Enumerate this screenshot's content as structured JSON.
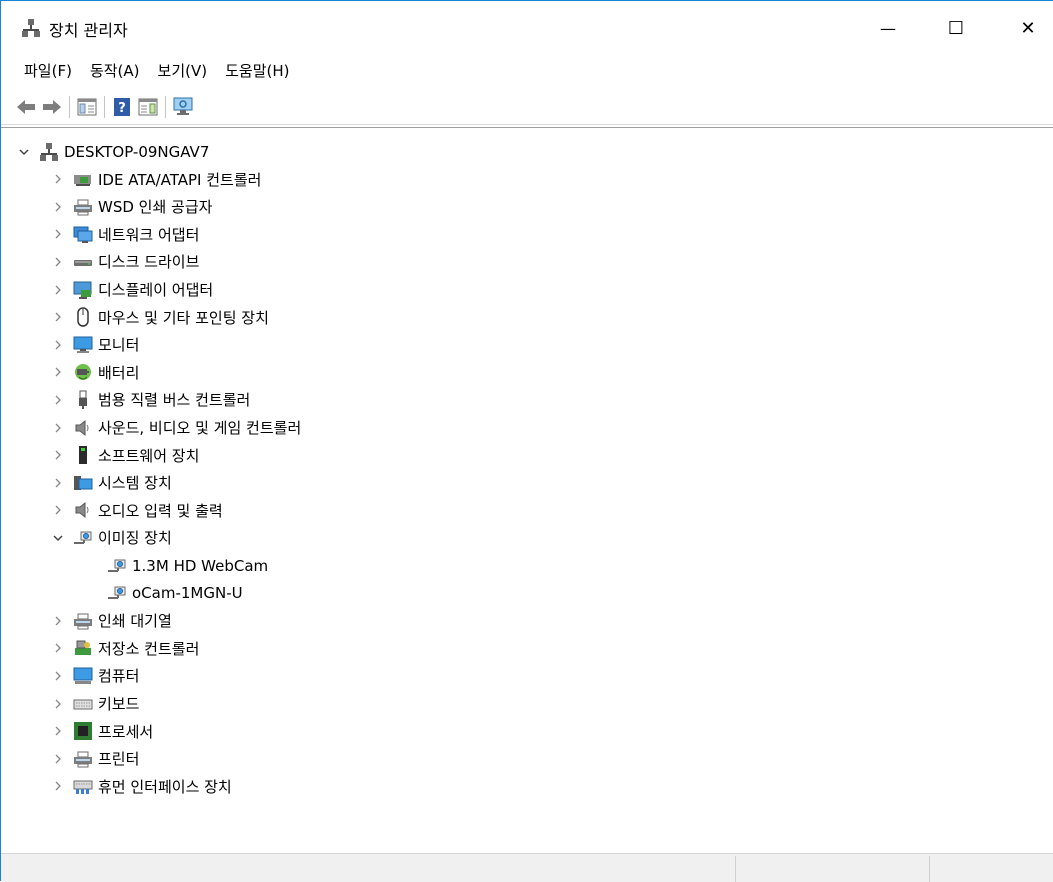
{
  "window": {
    "title": "장치 관리자",
    "minimize_glyph": "—",
    "maximize_glyph": "☐",
    "close_glyph": "✕"
  },
  "menu": [
    "파일(F)",
    "동작(A)",
    "보기(V)",
    "도움말(H)"
  ],
  "tree": {
    "root": {
      "label": "DESKTOP-09NGAV7",
      "icon": "computer-network-icon",
      "expanded": true
    },
    "categories": [
      {
        "label": "IDE ATA/ATAPI 컨트롤러",
        "icon": "ide-controller-icon",
        "expanded": false
      },
      {
        "label": "WSD 인쇄 공급자",
        "icon": "printer-icon",
        "expanded": false
      },
      {
        "label": "네트워크 어댑터",
        "icon": "network-adapter-icon",
        "expanded": false
      },
      {
        "label": "디스크 드라이브",
        "icon": "disk-drive-icon",
        "expanded": false
      },
      {
        "label": "디스플레이 어댑터",
        "icon": "display-adapter-icon",
        "expanded": false
      },
      {
        "label": "마우스 및 기타 포인팅 장치",
        "icon": "mouse-icon",
        "expanded": false
      },
      {
        "label": "모니터",
        "icon": "monitor-icon",
        "expanded": false
      },
      {
        "label": "배터리",
        "icon": "battery-icon",
        "expanded": false
      },
      {
        "label": "범용 직렬 버스 컨트롤러",
        "icon": "usb-icon",
        "expanded": false
      },
      {
        "label": "사운드, 비디오 및 게임 컨트롤러",
        "icon": "speaker-icon",
        "expanded": false
      },
      {
        "label": "소프트웨어 장치",
        "icon": "software-device-icon",
        "expanded": false
      },
      {
        "label": "시스템 장치",
        "icon": "system-device-icon",
        "expanded": false
      },
      {
        "label": "오디오 입력 및 출력",
        "icon": "speaker-icon",
        "expanded": false
      },
      {
        "label": "이미징 장치",
        "icon": "camera-icon",
        "expanded": true,
        "children": [
          {
            "label": "1.3M HD WebCam",
            "icon": "camera-icon"
          },
          {
            "label": "oCam-1MGN-U",
            "icon": "camera-icon"
          }
        ]
      },
      {
        "label": "인쇄 대기열",
        "icon": "printer-icon",
        "expanded": false
      },
      {
        "label": "저장소 컨트롤러",
        "icon": "storage-controller-icon",
        "expanded": false
      },
      {
        "label": "컴퓨터",
        "icon": "computer-icon",
        "expanded": false
      },
      {
        "label": "키보드",
        "icon": "keyboard-icon",
        "expanded": false
      },
      {
        "label": "프로세서",
        "icon": "processor-icon",
        "expanded": false
      },
      {
        "label": "프린터",
        "icon": "printer-icon",
        "expanded": false
      },
      {
        "label": "휴먼 인터페이스 장치",
        "icon": "hid-icon",
        "expanded": false
      }
    ]
  },
  "colors": {
    "window_border": "#1883d7",
    "statusbar_bg": "#f0f0f0"
  }
}
